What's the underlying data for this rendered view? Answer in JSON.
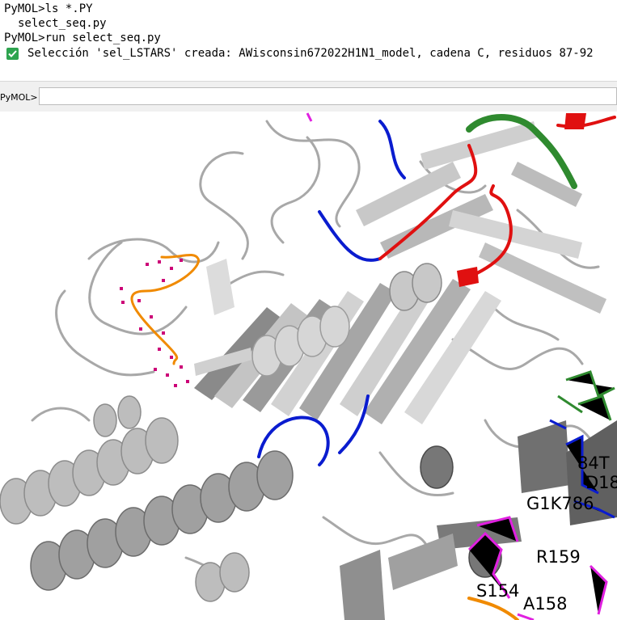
{
  "console": {
    "lines": [
      "PyMOL>ls *.PY",
      "select_seq.py",
      "PyMOL>run select_seq.py"
    ],
    "message": "Selección 'sel_LSTARS' creada: AWisconsin672022H1N1_model, cadena C, residuos 87-92",
    "message_icon": "check-box-icon"
  },
  "command": {
    "prompt_label": "PyMOL>",
    "input_value": ""
  },
  "viewer": {
    "residue_labels": [
      "84T",
      "D18",
      "G1K786",
      "R159",
      "S154",
      "A158"
    ]
  },
  "colors": {
    "backbone": "#bdbdbd",
    "highlight_blue": "#0a1ccf",
    "highlight_red": "#e01010",
    "highlight_green": "#2f8a2f",
    "highlight_magenta": "#e020e0",
    "highlight_orange": "#f08a00",
    "selection_dots": "#cc0077"
  }
}
